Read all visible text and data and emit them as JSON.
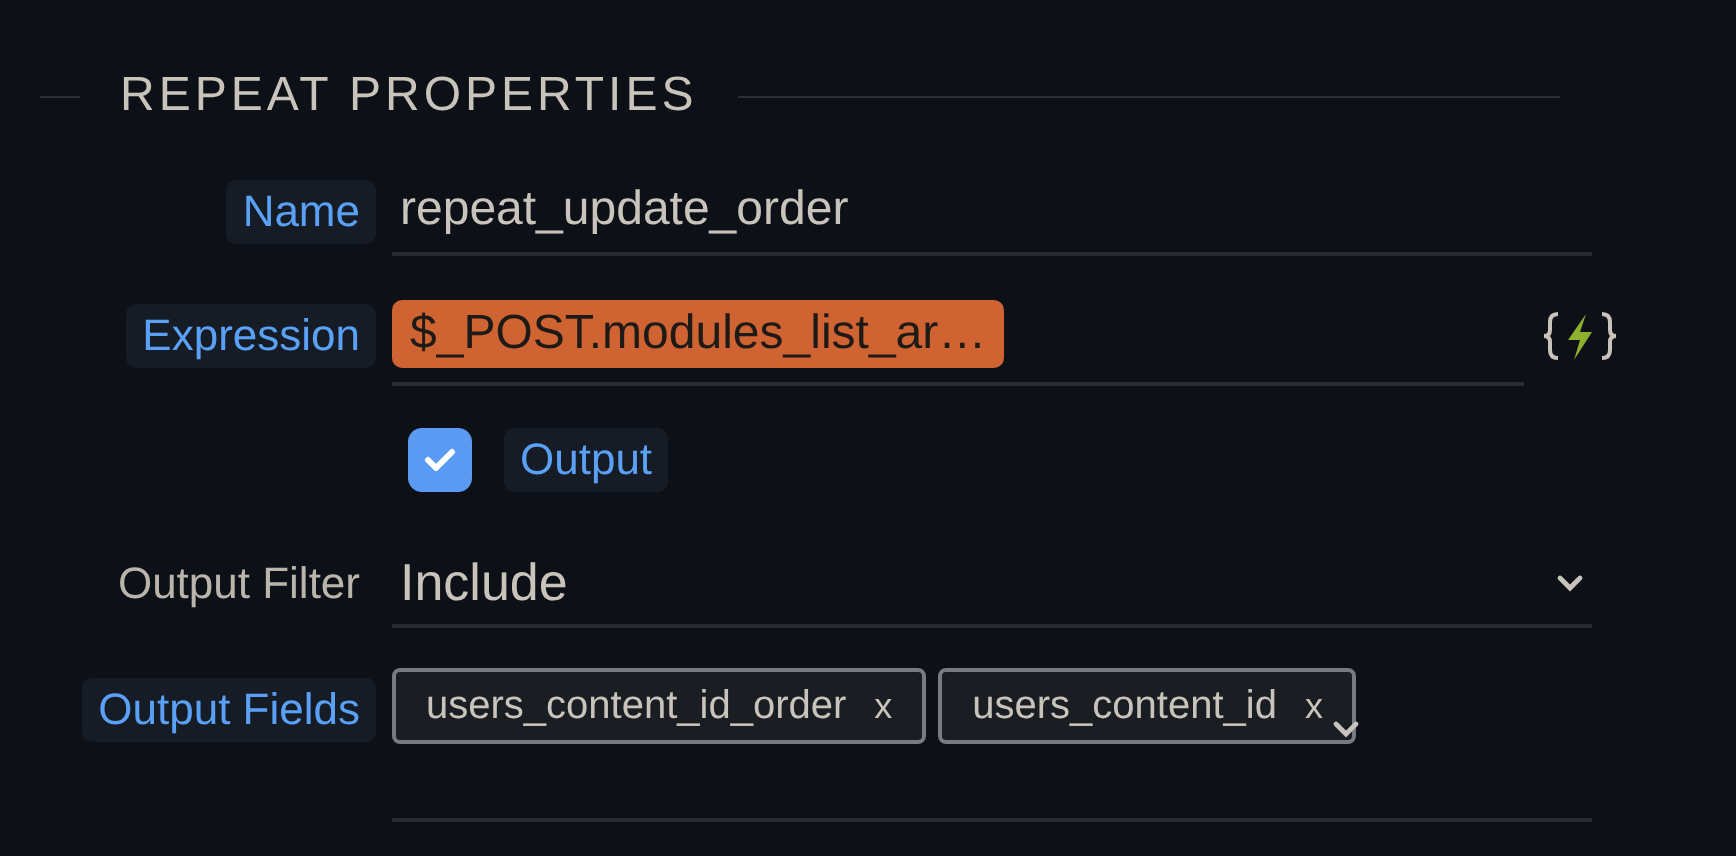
{
  "section": {
    "title": "REPEAT PROPERTIES"
  },
  "rows": [
    {
      "kind": "text",
      "label": "Name",
      "highlighted": true,
      "value": "repeat_update_order"
    },
    {
      "kind": "expression",
      "label": "Expression",
      "highlighted": true,
      "value": "$_POST.modules_list_ar…"
    },
    {
      "kind": "checkbox",
      "label": "Output",
      "highlighted": true,
      "checked": true
    },
    {
      "kind": "select",
      "label": "Output Filter",
      "highlighted": false,
      "value": "Include"
    },
    {
      "kind": "tags",
      "label": "Output Fields",
      "highlighted": true,
      "tags": [
        {
          "text": "users_content_id_order",
          "remove": "x"
        },
        {
          "text": "users_content_id",
          "remove": "x"
        }
      ]
    }
  ]
}
